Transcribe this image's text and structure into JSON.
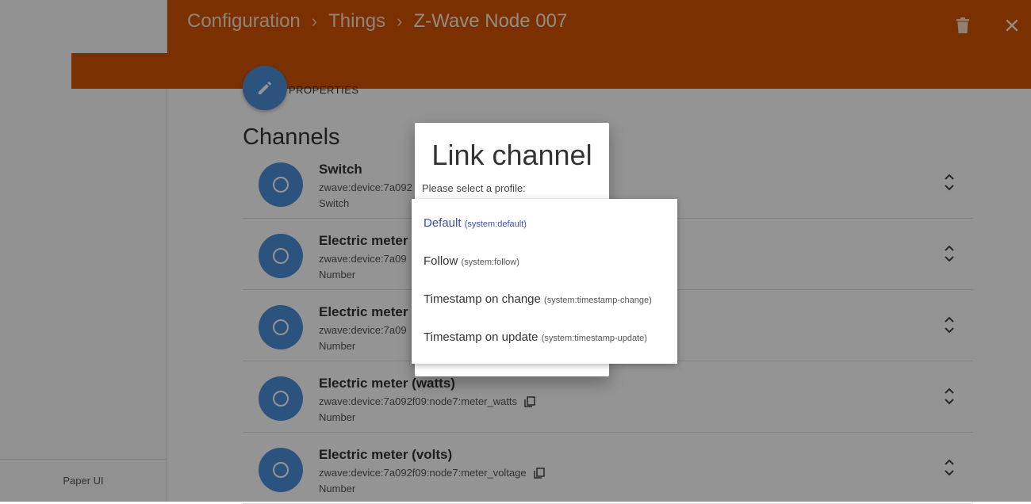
{
  "header": {
    "breadcrumb": [
      "Configuration",
      "Things",
      "Z-Wave Node 007"
    ],
    "separator": "›"
  },
  "sidebar": {
    "footer": "Paper UI"
  },
  "main": {
    "properties_label": "PROPERTIES",
    "channels_title": "Channels",
    "channels": [
      {
        "name": "Switch",
        "uid": "zwave:device:7a092",
        "type": "Switch",
        "copy": false
      },
      {
        "name": "Electric meter",
        "uid": "zwave:device:7a09",
        "type": "Number",
        "copy": false
      },
      {
        "name": "Electric meter",
        "uid": "zwave:device:7a09",
        "type": "Number",
        "copy": false
      },
      {
        "name": "Electric meter (watts)",
        "uid": "zwave:device:7a092f09:node7:meter_watts",
        "type": "Number",
        "copy": true
      },
      {
        "name": "Electric meter (volts)",
        "uid": "zwave:device:7a092f09:node7:meter_voltage",
        "type": "Number",
        "copy": true
      }
    ]
  },
  "dialog": {
    "title": "Link channel",
    "subtitle": "Please select a profile:"
  },
  "profiles": [
    {
      "label": "Default",
      "id": "(system:default)",
      "selected": true
    },
    {
      "label": "Follow",
      "id": "(system:follow)",
      "selected": false
    },
    {
      "label": "Timestamp on change",
      "id": "(system:timestamp-change)",
      "selected": false
    },
    {
      "label": "Timestamp on update",
      "id": "(system:timestamp-update)",
      "selected": false
    }
  ],
  "colors": {
    "header": "#d35400",
    "accent": "#4a90d9",
    "selected": "#3f51b5"
  },
  "icons": {
    "delete": "trash-icon",
    "close": "close-icon",
    "edit": "pencil-icon"
  }
}
